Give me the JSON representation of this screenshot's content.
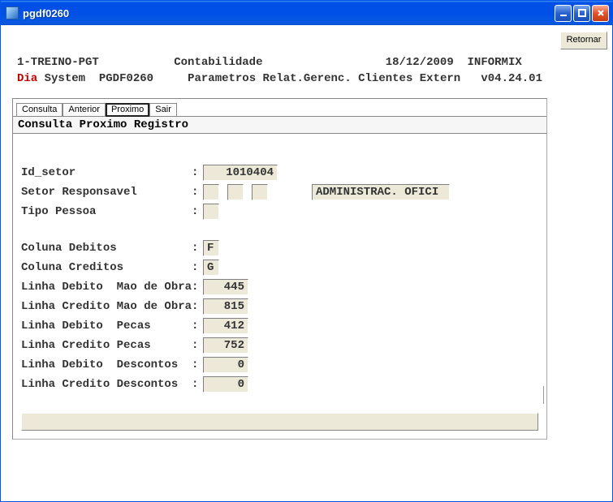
{
  "window": {
    "title": "pgdf0260"
  },
  "right": {
    "retornar": "Retornar"
  },
  "header": {
    "env": "1-TREINO-PGT",
    "module": "Contabilidade",
    "date": "18/12/2009",
    "db": "INFORMIX",
    "dia": "Dia",
    "system": "System",
    "program": "PGDF0260",
    "desc": "Parametros Relat.Gerenc. Clientes Extern",
    "version": "v04.24.01"
  },
  "tabs": {
    "consulta": "Consulta",
    "anterior": "Anterior",
    "proximo": "Proximo",
    "sair": "Sair"
  },
  "subheader": "Consulta Proximo Registro",
  "labels": {
    "id_setor": "Id_setor",
    "setor_resp": "Setor Responsavel",
    "tipo_pessoa": "Tipo Pessoa",
    "col_deb": "Coluna Debitos",
    "col_cred": "Coluna Creditos",
    "lin_deb_mo": "Linha Debito  Mao de Obra",
    "lin_cred_mo": "Linha Credito Mao de Obra",
    "lin_deb_pec": "Linha Debito  Pecas",
    "lin_cred_pec": "Linha Credito Pecas",
    "lin_deb_desc": "Linha Debito  Descontos",
    "lin_cred_desc": "Linha Credito Descontos"
  },
  "values": {
    "id_setor": "1010404",
    "setor_resp_desc": "ADMINISTRAC. OFICI",
    "col_deb": "F",
    "col_cred": "G",
    "lin_deb_mo": "445",
    "lin_cred_mo": "815",
    "lin_deb_pec": "412",
    "lin_cred_pec": "752",
    "lin_deb_desc": "0",
    "lin_cred_desc": "0"
  }
}
